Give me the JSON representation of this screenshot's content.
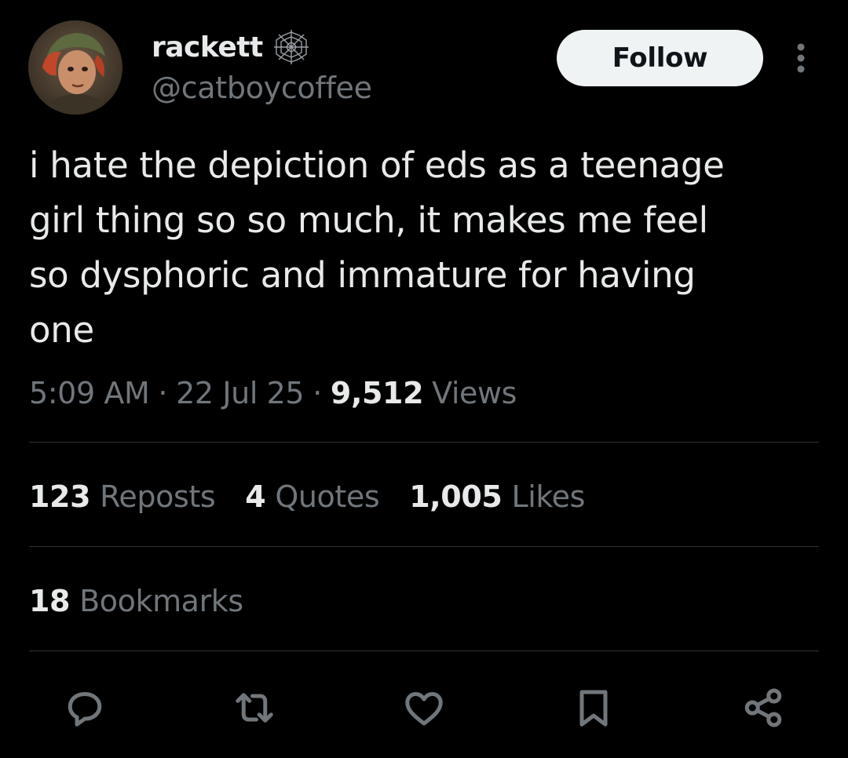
{
  "author": {
    "display_name": "rackett",
    "handle": "@catboycoffee",
    "name_emoji_icon": "spider-web-icon",
    "avatar_icon": "avatar-portrait"
  },
  "header": {
    "follow_label": "Follow",
    "more_icon": "more-vertical-icon"
  },
  "tweet": {
    "text": "i hate the depiction of eds as a teenage\ngirl thing so so much, it makes me feel\nso dysphoric and immature for having\none",
    "time": "5:09 AM",
    "date": "22 Jul 25",
    "separator": "·",
    "views_count": "9,512",
    "views_label": "Views"
  },
  "stats": {
    "reposts": {
      "count": "123",
      "label": "Reposts"
    },
    "quotes": {
      "count": "4",
      "label": "Quotes"
    },
    "likes": {
      "count": "1,005",
      "label": "Likes"
    },
    "bookmarks": {
      "count": "18",
      "label": "Bookmarks"
    }
  },
  "actions": [
    {
      "icon": "reply-icon"
    },
    {
      "icon": "repost-icon"
    },
    {
      "icon": "like-icon"
    },
    {
      "icon": "bookmark-icon"
    },
    {
      "icon": "share-icon"
    }
  ],
  "colors": {
    "background": "#000000",
    "primary_text": "#e7e9ea",
    "secondary_text": "#71767b",
    "divider": "#2f3336",
    "follow_button_bg": "#eff3f4",
    "follow_button_text": "#0f1419"
  }
}
